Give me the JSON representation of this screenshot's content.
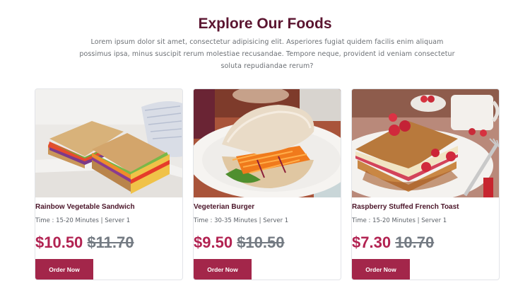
{
  "section": {
    "title": "Explore Our Foods",
    "description": "Lorem ipsum dolor sit amet, consectetur adipisicing elit. Asperiores fugiat quidem facilis enim aliquam possimus ipsa, minus suscipit rerum molestiae recusandae. Tempore neque, provident id veniam consectetur soluta repudiandae rerum?"
  },
  "colors": {
    "title": "#5b1530",
    "price": "#b22352",
    "button": "#a3264a"
  },
  "foods": [
    {
      "name": "Rainbow Vegetable Sandwich",
      "meta": "Time : 15-20 Minutes | Server 1",
      "price": "$10.50",
      "old_price": "$11.70",
      "button": "Order Now"
    },
    {
      "name": "Vegeterian Burger",
      "meta": "Time : 30-35 Minutes | Server 1",
      "price": "$9.50",
      "old_price": "$10.50",
      "button": "Order Now"
    },
    {
      "name": "Raspberry Stuffed French Toast",
      "meta": "Time : 15-20 Minutes | Server 1",
      "price": "$7.30",
      "old_price": "10.70",
      "button": "Order Now"
    }
  ]
}
